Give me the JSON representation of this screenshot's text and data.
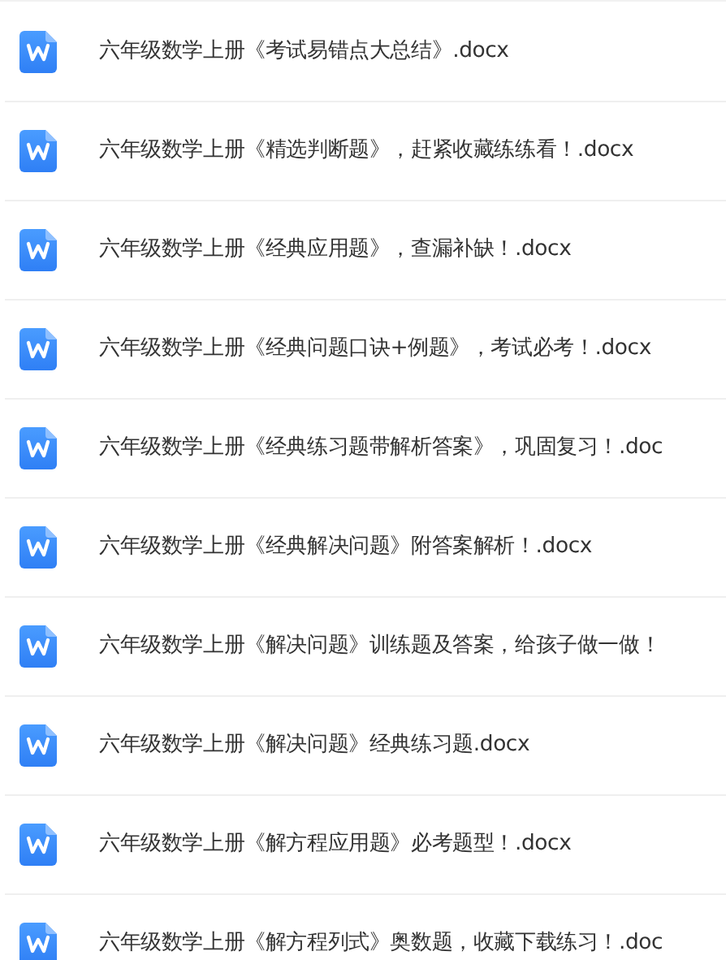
{
  "files": [
    {
      "name": "六年级数学上册《考试易错点大总结》.docx"
    },
    {
      "name": "六年级数学上册《精选判断题》，赶紧收藏练练看！.docx"
    },
    {
      "name": "六年级数学上册《经典应用题》，查漏补缺！.docx"
    },
    {
      "name": "六年级数学上册《经典问题口诀+例题》，考试必考！.docx"
    },
    {
      "name": "六年级数学上册《经典练习题带解析答案》，巩固复习！.doc"
    },
    {
      "name": "六年级数学上册《经典解决问题》附答案解析！.docx"
    },
    {
      "name": "六年级数学上册《解决问题》训练题及答案，给孩子做一做！"
    },
    {
      "name": "六年级数学上册《解决问题》经典练习题.docx"
    },
    {
      "name": "六年级数学上册《解方程应用题》必考题型！.docx"
    },
    {
      "name": "六年级数学上册《解方程列式》奥数题，收藏下载练习！.doc"
    }
  ]
}
